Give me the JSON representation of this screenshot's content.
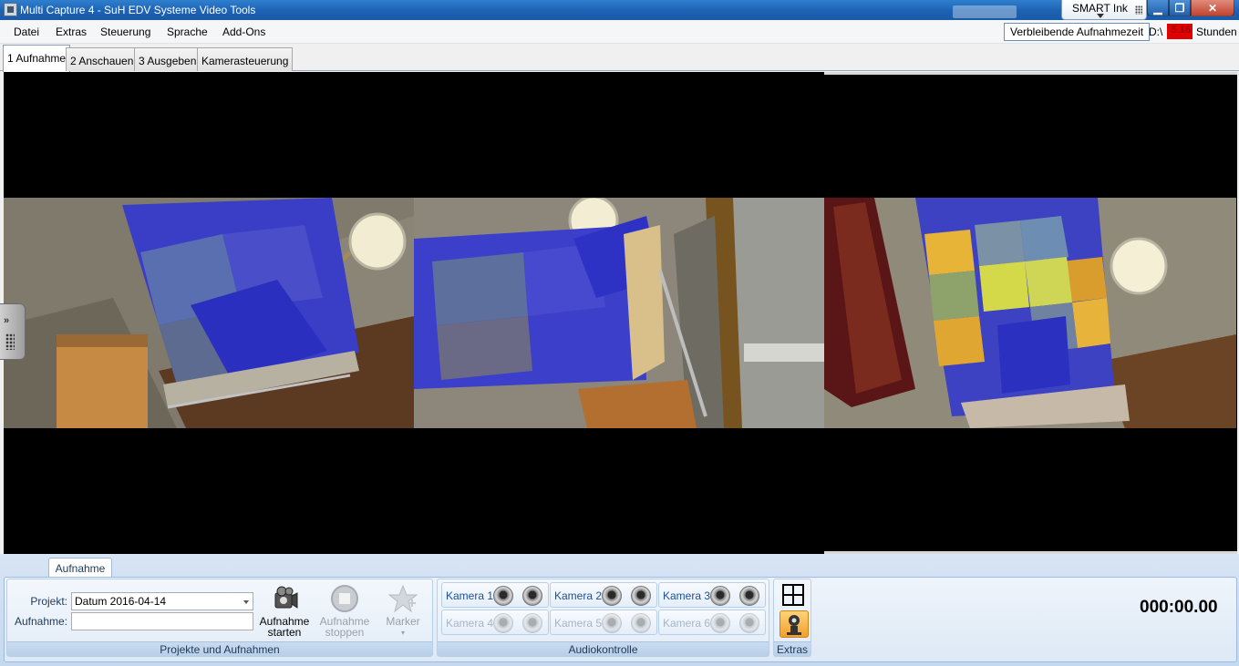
{
  "window": {
    "title": "Multi Capture 4 - SuH EDV Systeme Video Tools"
  },
  "smart_ink": {
    "label": "SMART Ink"
  },
  "window_controls": {
    "minimize": "▁",
    "maximize": "❐",
    "close": "✕"
  },
  "menu": {
    "items": [
      "Datei",
      "Extras",
      "Steuerung",
      "Sprache",
      "Add-Ons"
    ]
  },
  "status": {
    "remaining_label": "Verbleibende Aufnahmezeit",
    "drive": "D:\\",
    "hours_value": "5.16",
    "hours_unit": "Stunden"
  },
  "tabs": [
    {
      "label": "1 Aufnahme",
      "active": true
    },
    {
      "label": "2 Anschauen",
      "active": false
    },
    {
      "label": "3 Ausgeben",
      "active": false
    },
    {
      "label": "Kamerasteuerung",
      "active": false
    }
  ],
  "ribbon": {
    "tab_label": "Aufnahme",
    "projects": {
      "project_label": "Projekt:",
      "project_value": "Datum 2016-04-14",
      "recording_label": "Aufnahme:",
      "recording_value": "",
      "start_line1": "Aufnahme",
      "start_line2": "starten",
      "stop_line1": "Aufnahme",
      "stop_line2": "stoppen",
      "marker_label": "Marker",
      "caption": "Projekte und Aufnahmen"
    },
    "audio": {
      "cameras": [
        {
          "label": "Kamera 1",
          "enabled": true
        },
        {
          "label": "Kamera 2",
          "enabled": true
        },
        {
          "label": "Kamera 3",
          "enabled": true
        },
        {
          "label": "Kamera 4",
          "enabled": false
        },
        {
          "label": "Kamera 5",
          "enabled": false
        },
        {
          "label": "Kamera 6",
          "enabled": false
        }
      ],
      "caption": "Audiokontrolle"
    },
    "extras": {
      "caption": "Extras"
    }
  },
  "timer": "000:00.00",
  "icons": {
    "app": "app-icon",
    "grid": "grid-layout-icon",
    "start": "camcorder-icon",
    "stop": "stop-icon",
    "marker": "star-marker-icon",
    "webcam": "webcam-icon",
    "speaker": "speaker-icon"
  }
}
